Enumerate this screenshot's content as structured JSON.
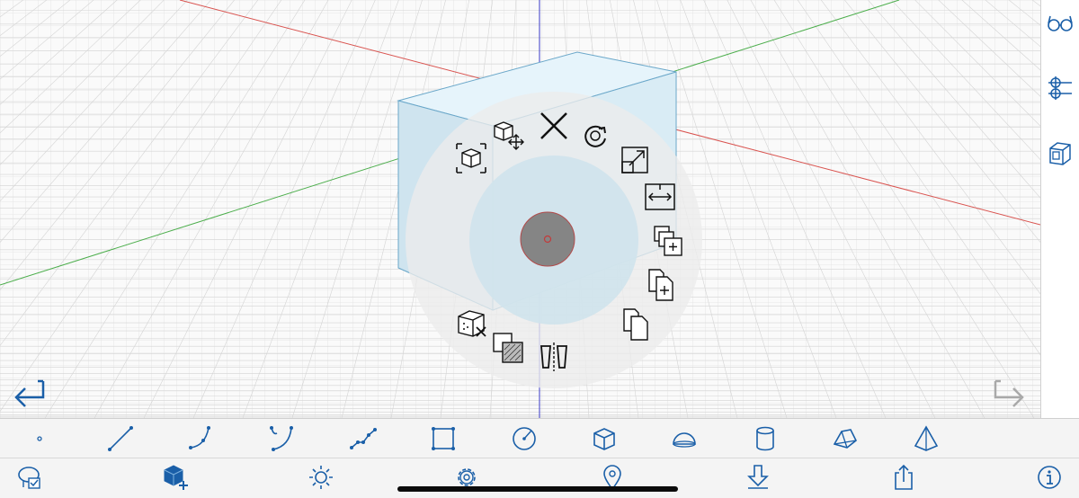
{
  "colors": {
    "accent": "#1a5fa8",
    "axis_x": "#d9534f",
    "axis_y": "#4cae4c",
    "axis_z": "#3c3cc8",
    "selection": "#d8ecf6",
    "disabled": "#a9a9a9"
  },
  "viewport": {
    "undo_icon": "undo-arrow-icon",
    "redo_icon": "redo-arrow-icon",
    "redo_enabled": false
  },
  "radial_menu": {
    "center_icon": "menu-center-knob-icon",
    "items": [
      {
        "name": "delete",
        "icon": "close-x-icon"
      },
      {
        "name": "rotate",
        "icon": "rotate-icon"
      },
      {
        "name": "scale",
        "icon": "scale-diagonal-icon"
      },
      {
        "name": "extrude",
        "icon": "resize-horizontal-icon"
      },
      {
        "name": "duplicate-multiple",
        "icon": "duplicate-stack-icon"
      },
      {
        "name": "paste",
        "icon": "paste-document-icon"
      },
      {
        "name": "copy",
        "icon": "copy-documents-icon"
      },
      {
        "name": "mirror",
        "icon": "mirror-icon"
      },
      {
        "name": "subtract",
        "icon": "boolean-subtract-icon"
      },
      {
        "name": "delete-solid",
        "icon": "cube-delete-icon"
      },
      {
        "name": "select-solid",
        "icon": "cube-select-icon"
      },
      {
        "name": "move",
        "icon": "cube-move-icon"
      }
    ]
  },
  "right_rail": [
    {
      "name": "view-mode",
      "icon": "glasses-icon"
    },
    {
      "name": "layers",
      "icon": "layers-slider-icon"
    },
    {
      "name": "section",
      "icon": "section-cube-icon"
    }
  ],
  "draw_tools": [
    {
      "name": "point",
      "icon": "point-icon"
    },
    {
      "name": "line",
      "icon": "line-icon"
    },
    {
      "name": "arc",
      "icon": "arc-icon"
    },
    {
      "name": "curve",
      "icon": "curve-icon"
    },
    {
      "name": "polyline",
      "icon": "polyline-icon"
    },
    {
      "name": "rectangle",
      "icon": "rectangle-icon"
    },
    {
      "name": "circle",
      "icon": "circle-icon"
    },
    {
      "name": "box",
      "icon": "box-icon"
    },
    {
      "name": "dome",
      "icon": "dome-icon"
    },
    {
      "name": "cylinder",
      "icon": "cylinder-icon"
    },
    {
      "name": "wedge",
      "icon": "wedge-icon"
    },
    {
      "name": "pyramid",
      "icon": "pyramid-icon"
    }
  ],
  "bottom_bar": [
    {
      "name": "sketch-select",
      "icon": "lasso-check-icon"
    },
    {
      "name": "add-solid",
      "icon": "cube-plus-icon"
    },
    {
      "name": "lighting",
      "icon": "sun-icon"
    },
    {
      "name": "settings",
      "icon": "gear-icon"
    },
    {
      "name": "location",
      "icon": "location-pin-icon"
    },
    {
      "name": "import",
      "icon": "download-arrow-icon"
    },
    {
      "name": "share",
      "icon": "share-icon"
    },
    {
      "name": "info",
      "icon": "info-icon"
    }
  ]
}
